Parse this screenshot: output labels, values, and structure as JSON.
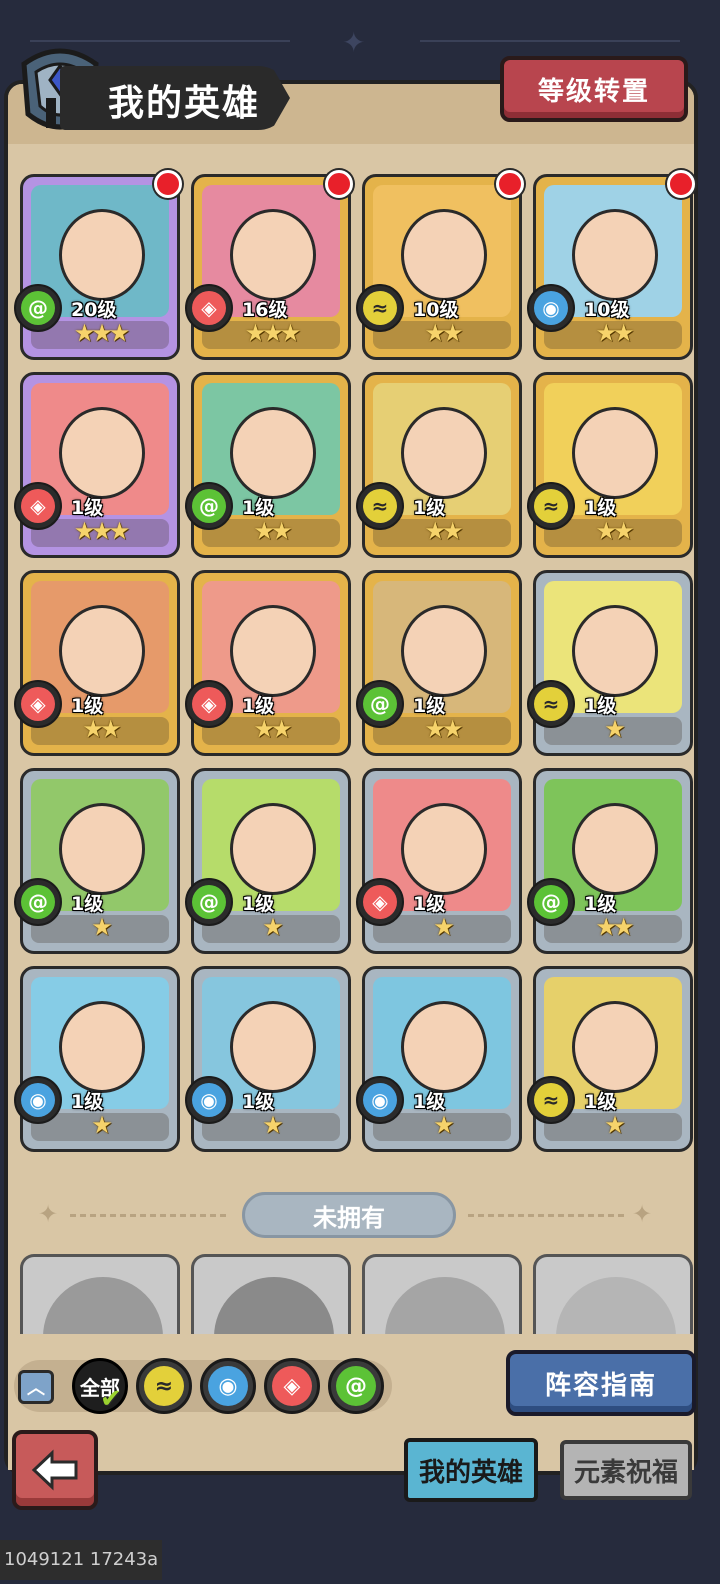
{
  "header": {
    "title": "我的英雄",
    "level_transfer_label": "等级转置"
  },
  "colors": {
    "wind": "#5cc236",
    "fire": "#ee5a5a",
    "water": "#4aa3e0",
    "earth": "#e3d03a",
    "gold_card": "#e4b34a",
    "purple_card": "#b493e3",
    "silver_card": "#a9b6c1"
  },
  "heroes": [
    {
      "level": "20级",
      "stars": "★★★",
      "element": "wind",
      "rarity": "purple",
      "bg": "#6fb8c8",
      "dot": true
    },
    {
      "level": "16级",
      "stars": "★★★",
      "element": "fire",
      "rarity": "gold",
      "bg": "#e68aa0",
      "dot": true
    },
    {
      "level": "10级",
      "stars": "★★",
      "element": "earth",
      "rarity": "gold",
      "bg": "#f0c060",
      "dot": true
    },
    {
      "level": "10级",
      "stars": "★★",
      "element": "water",
      "rarity": "gold",
      "bg": "#9fd2e6",
      "dot": true
    },
    {
      "level": "1级",
      "stars": "★★★",
      "element": "fire",
      "rarity": "purple",
      "bg": "#ef8a8a",
      "dot": false
    },
    {
      "level": "1级",
      "stars": "★★",
      "element": "wind",
      "rarity": "gold",
      "bg": "#7cc6a3",
      "dot": false
    },
    {
      "level": "1级",
      "stars": "★★",
      "element": "earth",
      "rarity": "gold",
      "bg": "#e6cf74",
      "dot": false
    },
    {
      "level": "1级",
      "stars": "★★",
      "element": "earth",
      "rarity": "gold",
      "bg": "#f1d05a",
      "dot": false
    },
    {
      "level": "1级",
      "stars": "★★",
      "element": "fire",
      "rarity": "gold",
      "bg": "#e69a6a",
      "dot": false
    },
    {
      "level": "1级",
      "stars": "★★",
      "element": "fire",
      "rarity": "gold",
      "bg": "#ee9a8a",
      "dot": false
    },
    {
      "level": "1级",
      "stars": "★★",
      "element": "wind",
      "rarity": "gold",
      "bg": "#d7b77a",
      "dot": false
    },
    {
      "level": "1级",
      "stars": "★",
      "element": "earth",
      "rarity": "silver",
      "bg": "#ebe47a",
      "dot": false
    },
    {
      "level": "1级",
      "stars": "★",
      "element": "wind",
      "rarity": "silver",
      "bg": "#92c86a",
      "dot": false
    },
    {
      "level": "1级",
      "stars": "★",
      "element": "wind",
      "rarity": "silver",
      "bg": "#b6dc6a",
      "dot": false
    },
    {
      "level": "1级",
      "stars": "★",
      "element": "fire",
      "rarity": "silver",
      "bg": "#ee8a8a",
      "dot": false
    },
    {
      "level": "1级",
      "stars": "★★",
      "element": "wind",
      "rarity": "silver",
      "bg": "#7ec45a",
      "dot": false
    },
    {
      "level": "1级",
      "stars": "★",
      "element": "water",
      "rarity": "silver",
      "bg": "#86cce6",
      "dot": false
    },
    {
      "level": "1级",
      "stars": "★",
      "element": "water",
      "rarity": "silver",
      "bg": "#86c6de",
      "dot": false
    },
    {
      "level": "1级",
      "stars": "★",
      "element": "water",
      "rarity": "silver",
      "bg": "#7ec6e0",
      "dot": false
    },
    {
      "level": "1级",
      "stars": "★",
      "element": "earth",
      "rarity": "silver",
      "bg": "#e6d06a",
      "dot": false
    }
  ],
  "not_owned_label": "未拥有",
  "filter": {
    "all_label": "全部"
  },
  "lineup_guide_label": "阵容指南",
  "tabs": {
    "my_heroes": "我的英雄",
    "element_blessing": "元素祝福"
  },
  "footer_text": "1049121 17243a"
}
